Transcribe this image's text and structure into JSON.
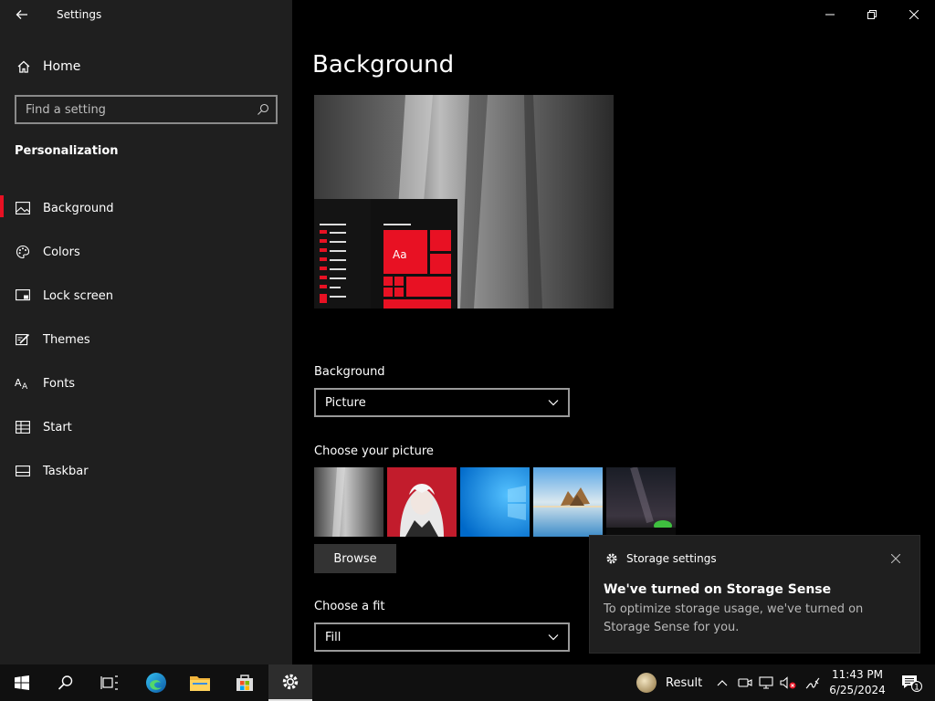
{
  "window": {
    "title": "Settings",
    "back_icon": "back-arrow-icon",
    "controls": [
      "minimize-icon",
      "restore-icon",
      "close-icon"
    ]
  },
  "sidebar": {
    "home_label": "Home",
    "search_placeholder": "Find a setting",
    "section_title": "Personalization",
    "items": [
      {
        "label": "Background",
        "icon": "picture-icon",
        "active": true
      },
      {
        "label": "Colors",
        "icon": "palette-icon",
        "active": false
      },
      {
        "label": "Lock screen",
        "icon": "lock-screen-icon",
        "active": false
      },
      {
        "label": "Themes",
        "icon": "themes-icon",
        "active": false
      },
      {
        "label": "Fonts",
        "icon": "fonts-icon",
        "active": false
      },
      {
        "label": "Start",
        "icon": "start-icon",
        "active": false
      },
      {
        "label": "Taskbar",
        "icon": "taskbar-icon",
        "active": false
      }
    ]
  },
  "main": {
    "page_title": "Background",
    "preview_sample_text": "Aa",
    "background_label": "Background",
    "background_value": "Picture",
    "choose_picture_label": "Choose your picture",
    "browse_label": "Browse",
    "fit_label": "Choose a fit",
    "fit_value": "Fill"
  },
  "toast": {
    "app": "Storage settings",
    "heading": "We've turned on Storage Sense",
    "body": "To optimize storage usage, we've turned on Storage Sense for you."
  },
  "taskbar": {
    "weather_label": "Result",
    "time": "11:43 PM",
    "date": "6/25/2024",
    "notification_count": "1"
  },
  "colors": {
    "accent": "#e81123",
    "sidebar_bg": "#1f1f1f",
    "main_bg": "#000000",
    "taskbar_bg": "#101010"
  }
}
